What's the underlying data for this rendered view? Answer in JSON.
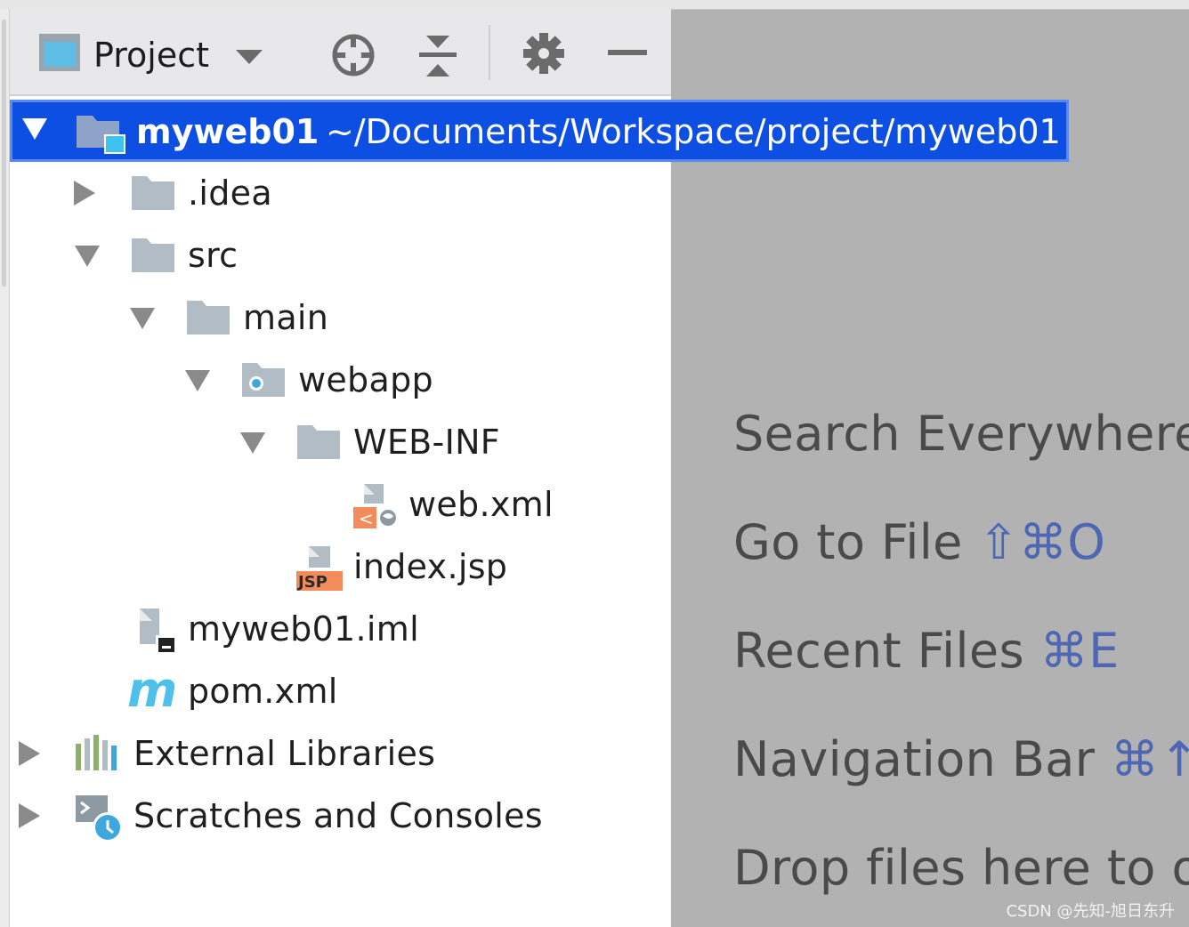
{
  "toolbar": {
    "view_label": "Project",
    "icons": [
      "project-view-icon",
      "chevron-down-icon",
      "locate-icon",
      "collapse-all-icon",
      "gear-icon",
      "minimize-icon"
    ]
  },
  "tree": {
    "root": {
      "name": "myweb01",
      "path": "~/Documents/Workspace/project/myweb01"
    },
    "items": [
      {
        "label": ".idea"
      },
      {
        "label": "src"
      },
      {
        "label": "main"
      },
      {
        "label": "webapp"
      },
      {
        "label": "WEB-INF"
      },
      {
        "label": "web.xml"
      },
      {
        "label": "index.jsp",
        "badge": "JSP"
      },
      {
        "label": "myweb01.iml"
      },
      {
        "label": "pom.xml",
        "badge": "m"
      },
      {
        "label": "External Libraries"
      },
      {
        "label": "Scratches and Consoles"
      }
    ]
  },
  "welcome": {
    "hints": [
      {
        "text": "Search Everywhere",
        "shortcut": ""
      },
      {
        "text": "Go to File",
        "shortcut": "⇧⌘O"
      },
      {
        "text": "Recent Files",
        "shortcut": "⌘E"
      },
      {
        "text": "Navigation Bar",
        "shortcut": "⌘↑"
      },
      {
        "text": "Drop files here to o",
        "shortcut": ""
      }
    ]
  },
  "watermark": "CSDN @先知-旭日东升",
  "colors": {
    "selection": "#0d4fe3",
    "folder": "#b1bcc4",
    "shortcut": "#4e67b4",
    "editor_bg": "#b2b2b2"
  }
}
